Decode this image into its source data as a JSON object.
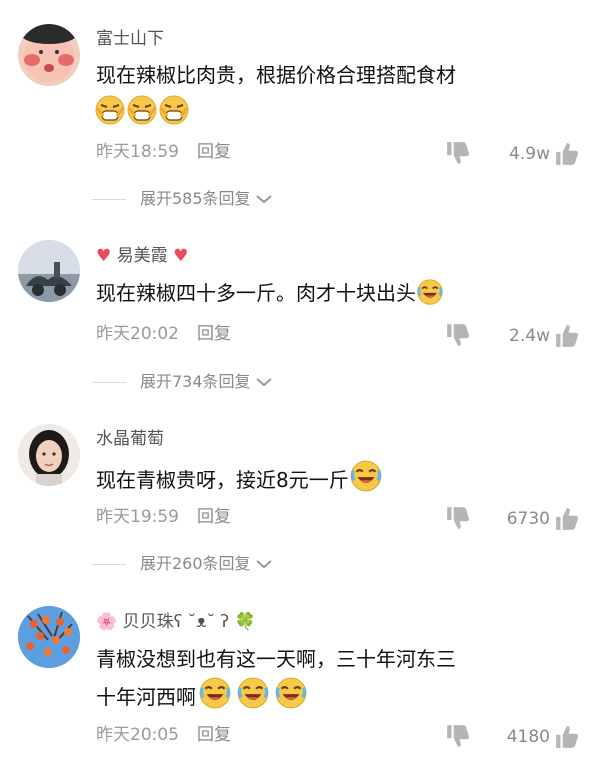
{
  "comments": [
    {
      "username": "富士山下",
      "text": "现在辣椒比肉贵，根据价格合理搭配食材",
      "time": "昨天18:59",
      "reply_label": "回复",
      "likes": "4.9w",
      "expand_label": "展开585条回复",
      "avatar_colors": [
        "#f3c9b8",
        "#e07a6a",
        "#2b2b2b"
      ]
    },
    {
      "username_prefix": "♥",
      "username": "易美霞",
      "username_suffix": "♥",
      "text": "现在辣椒四十多一斤。肉才十块出头",
      "time": "昨天20:02",
      "reply_label": "回复",
      "likes": "2.4w",
      "expand_label": "展开734条回复"
    },
    {
      "username": "水晶葡萄",
      "text": "现在青椒贵呀，接近8元一斤",
      "time": "昨天19:59",
      "reply_label": "回复",
      "likes": "6730",
      "expand_label": "展开260条回复"
    },
    {
      "username_prefix": "🌸",
      "username": "贝贝珠ʕ ˘ᴥ˘ ʔ",
      "username_suffix": "🍀",
      "text_line1": "青椒没想到也有这一天啊，三十年河东三",
      "text_line2": "十年河西啊",
      "time": "昨天20:05",
      "reply_label": "回复",
      "likes": "4180"
    }
  ],
  "colors": {
    "meta_gray": "#9a9a9a",
    "heart_red": "#e84a5f",
    "icon_gray": "#b5b5b5",
    "emoji_yellow": "#f7c948"
  }
}
